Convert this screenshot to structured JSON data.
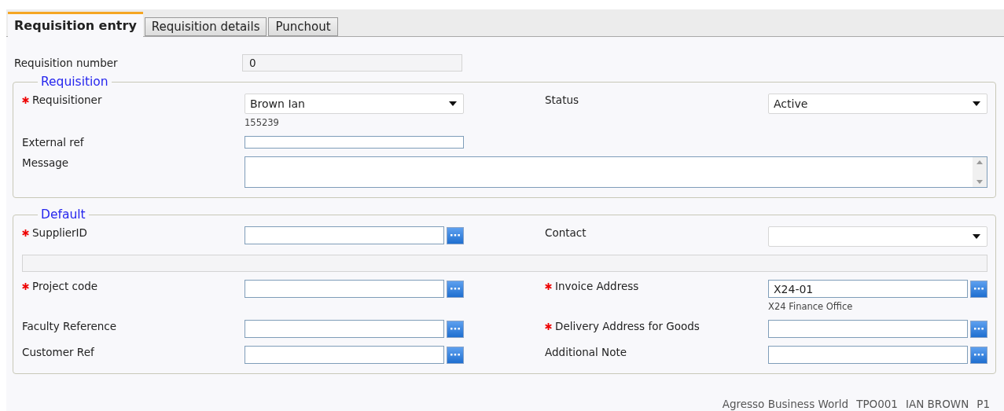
{
  "tabs": [
    {
      "label": "Requisition entry",
      "selected": true
    },
    {
      "label": "Requisition details",
      "selected": false
    },
    {
      "label": "Punchout",
      "selected": false
    }
  ],
  "requisition_number": {
    "label": "Requisition number",
    "value": "0"
  },
  "sections": [
    {
      "legend": "Requisition",
      "rows": [
        {
          "kind": "pair",
          "left": {
            "label": "Requisitioner",
            "required": true,
            "kind": "dropdown",
            "value": "Brown Ian",
            "hint": "155239"
          },
          "right": {
            "label": "Status",
            "required": false,
            "kind": "dropdown",
            "value": "Active"
          }
        },
        {
          "kind": "pair",
          "left": {
            "label": "External ref",
            "required": false,
            "kind": "text"
          }
        },
        {
          "kind": "wide",
          "left": {
            "label": "Message",
            "required": false,
            "kind": "textarea"
          }
        }
      ]
    },
    {
      "legend": "Default",
      "rows": [
        {
          "kind": "pair",
          "left": {
            "label": "SupplierID",
            "required": true,
            "kind": "lookup"
          },
          "right": {
            "label": "Contact",
            "required": false,
            "kind": "dropdown"
          }
        },
        {
          "kind": "bar"
        },
        {
          "kind": "pair",
          "left": {
            "label": "Project code",
            "required": true,
            "kind": "lookup"
          },
          "right": {
            "label": "Invoice Address",
            "required": true,
            "kind": "lookup",
            "value": "X24-01",
            "hint": "X24 Finance Office"
          }
        },
        {
          "kind": "pair",
          "left": {
            "label": "Faculty Reference",
            "required": false,
            "kind": "lookup"
          },
          "right": {
            "label": "Delivery Address for Goods",
            "required": true,
            "kind": "lookup"
          }
        },
        {
          "kind": "pair",
          "left": {
            "label": "Customer Ref",
            "required": false,
            "kind": "lookup"
          },
          "right": {
            "label": "Additional Note",
            "required": false,
            "kind": "lookup"
          }
        }
      ]
    }
  ],
  "status_bar": [
    "Agresso Business World",
    "TPO001",
    "IAN BROWN",
    "P1"
  ]
}
